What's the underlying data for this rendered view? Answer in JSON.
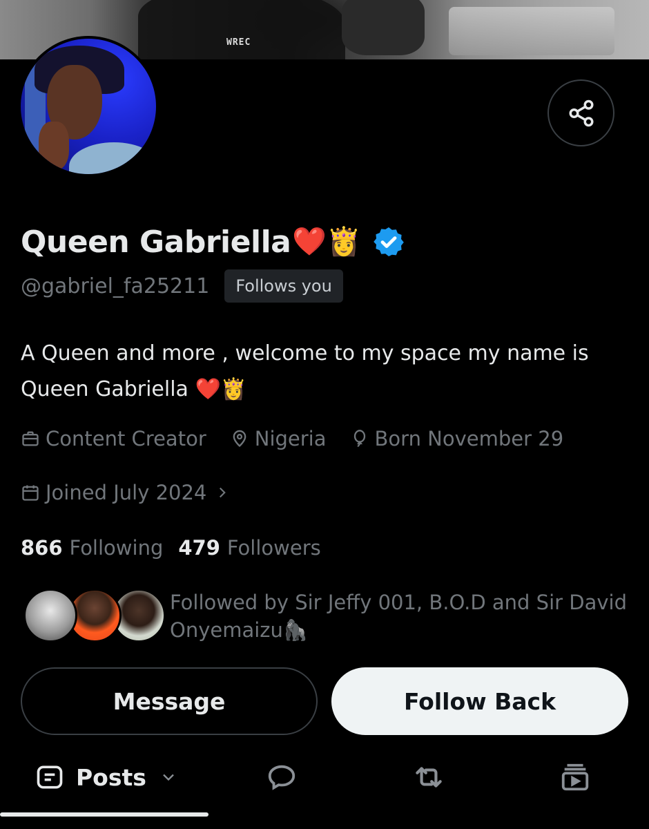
{
  "banner": {
    "shirt_text": "WREC"
  },
  "profile": {
    "name": "Queen Gabriella",
    "name_emojis": "❤️👸",
    "handle": "@gabriel_fa25211",
    "follows_you": "Follows you",
    "bio_line1": "A Queen and more , welcome to my space my name is",
    "bio_line2": "Queen Gabriella ❤️👸",
    "profession": "Content Creator",
    "location": "Nigeria",
    "birthday": "Born November 29",
    "joined": "Joined July 2024",
    "following_count": "866",
    "following_label": "Following",
    "followers_count": "479",
    "followers_label": "Followers",
    "followed_by_line1": "Followed by Sir Jeffy 001, B.O.D and Sir David",
    "followed_by_line2": "Onyemaizu🦍"
  },
  "buttons": {
    "message": "Message",
    "follow_back": "Follow Back"
  },
  "tabs": {
    "posts": "Posts"
  },
  "icons": {
    "share": "share-icon",
    "verified": "verified-badge-icon",
    "profession": "briefcase-icon",
    "location": "location-pin-icon",
    "birthday": "balloon-icon",
    "joined": "calendar-icon",
    "posts": "posts-icon",
    "replies": "reply-bubble-icon",
    "reposts": "repost-icon",
    "media": "media-icon"
  },
  "colors": {
    "background": "#000000",
    "primary_text": "#e7e9ea",
    "secondary_text": "#71767b",
    "verified_blue": "#1d9bf0",
    "follow_button_bg": "#eff3f4"
  }
}
